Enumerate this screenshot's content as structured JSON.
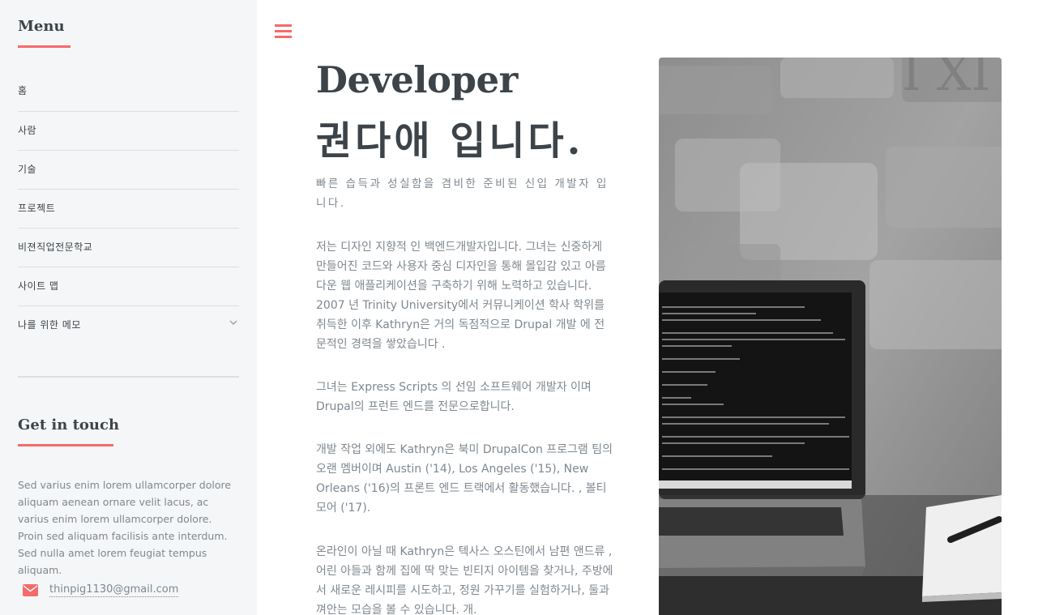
{
  "sidebar": {
    "menu_heading": "Menu",
    "menu_items": [
      {
        "label": "홈"
      },
      {
        "label": "사람"
      },
      {
        "label": "기술"
      },
      {
        "label": "프로젝트"
      },
      {
        "label": "비젼직업전문학교"
      },
      {
        "label": "사이트 맵"
      },
      {
        "label": "나를 위한 메모"
      }
    ],
    "contact_heading": "Get in touch",
    "contact_description": "Sed varius enim lorem ullamcorper dolore aliquam aenean ornare velit lacus, ac varius enim lorem ullamcorper dolore. Proin sed aliquam facilisis ante interdum. Sed nulla amet lorem feugiat tempus aliquam.",
    "email": "thinpig1130@gmail.com"
  },
  "main": {
    "title_line1": "Developer",
    "title_line2": "권다애 입니다.",
    "subtitle": "빠른 습득과 성실함을 겸비한 준비된 신입 개발자 입니다.",
    "paragraphs": [
      "저는 디자인 지향적 인 백엔드개발자입니다. 그녀는 신중하게 만들어진 코드와 사용자 중심 디자인을 통해 몰입감 있고 아름다운 웹 애플리케이션을 구축하기 위해 노력하고 있습니다. 2007 년 Trinity University에서 커뮤니케이션 학사 학위를 취득한 이후 Kathryn은 거의 독점적으로 Drupal 개발 에 전문적인 경력을 쌓았습니다 .",
      "그녀는 Express Scripts 의 선임 소프트웨어 개발자 이며 Drupal의 프런트 엔드를 전문으로합니다.",
      "개발 작업 외에도 Kathryn은 북미 DrupalCon 프로그램 팀의 오랜 멤버이며 Austin ('14), Los Angeles ('15), New Orleans ('16)의 프론트 엔드 트랙에서 활동했습니다. , 볼티모어 ('17).",
      "온라인이 아닐 때 Kathryn은 텍사스 오스틴에서 남편 앤드류 , 어린 아들과 함께 집에 딱 맞는 빈티지 아이템을 찾거나, 주방에서 새로운 레시피를 시도하고, 정원 가꾸기를 실험하거나, 둘과 껴안는 모습을 볼 수 있습니다. 개."
    ]
  },
  "colors": {
    "accent": "#f56a6a",
    "heading": "#3d4449",
    "text": "#7f888f",
    "sidebar_bg": "#f5f6f7"
  },
  "icons": {
    "menu_toggle": "hamburger-icon",
    "dropdown": "chevron-down-icon",
    "email": "envelope-icon"
  }
}
